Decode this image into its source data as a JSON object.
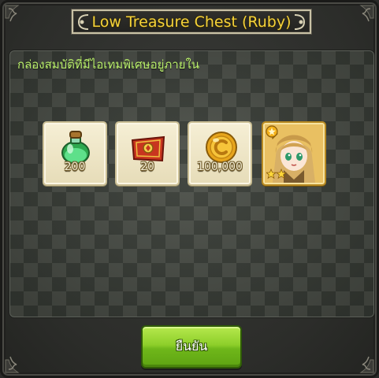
{
  "dialog": {
    "title": "Low Treasure Chest (Ruby)",
    "description": "กล่องสมบัติที่มีไอเทมพิเศษอยู่ภายใน",
    "confirm_label": "ยืนยัน"
  },
  "rewards": [
    {
      "icon": "green-potion-icon",
      "quantity": "200"
    },
    {
      "icon": "red-ticket-icon",
      "quantity": "20"
    },
    {
      "icon": "gold-coin-icon",
      "quantity": "100,000"
    },
    {
      "icon": "hero-portrait-icon",
      "quantity": "",
      "stars": 2
    }
  ],
  "colors": {
    "title": "#f4d23a",
    "description": "#b9ef6b",
    "button": "#8dcf2a"
  }
}
